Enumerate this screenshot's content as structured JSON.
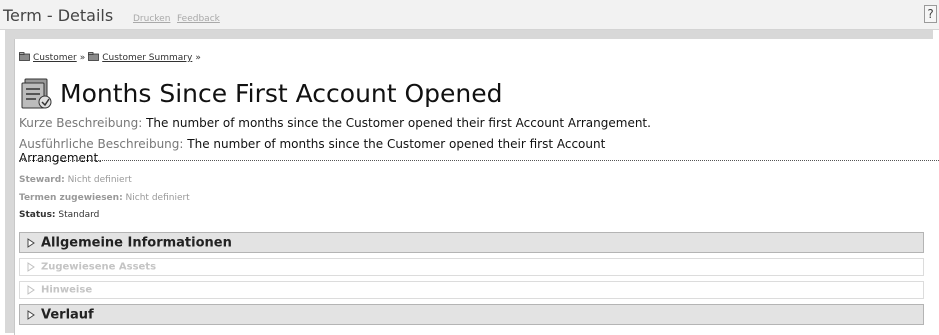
{
  "header": {
    "title": "Term - Details",
    "print_link": "Drucken",
    "feedback_link": "Feedback",
    "help_label": "?"
  },
  "breadcrumb": {
    "items": [
      "Customer",
      "Customer Summary"
    ],
    "separator": "»"
  },
  "term": {
    "title": "Months Since First Account Opened",
    "short_desc_label": "Kurze Beschreibung:",
    "short_desc": "The number of months since the Customer opened their first Account Arrangement.",
    "long_desc_label": "Ausführliche Beschreibung:",
    "long_desc": "The number of months since the Customer opened their first Account Arrangement."
  },
  "meta": {
    "steward_label": "Steward:",
    "steward_value": "Nicht definiert",
    "assigned_label": "Termen zugewiesen:",
    "assigned_value": "Nicht definiert",
    "status_label": "Status:",
    "status_value": "Standard"
  },
  "sections": [
    {
      "label": "Allgemeine Informationen",
      "enabled": true
    },
    {
      "label": "Zugewiesene Assets",
      "enabled": false
    },
    {
      "label": "Hinweise",
      "enabled": false
    },
    {
      "label": "Verlauf",
      "enabled": true
    }
  ],
  "colors": {
    "frame": "#d8d8d8",
    "section_active_bg": "#e3e3e3",
    "section_disabled_text": "#c4c4c4",
    "label_gray": "#777777"
  }
}
